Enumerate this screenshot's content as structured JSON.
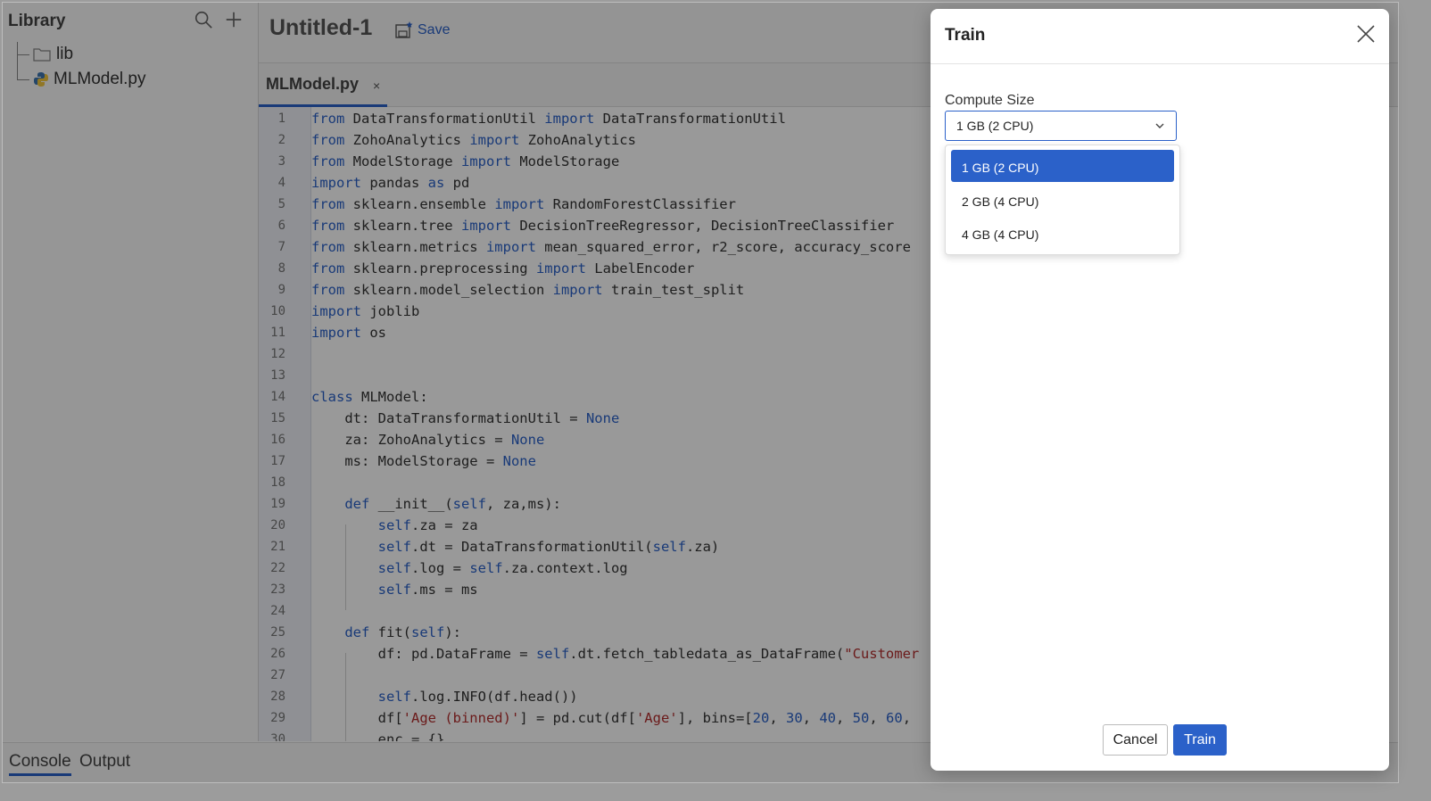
{
  "sidebar": {
    "title": "Library",
    "tree": [
      {
        "label": "lib",
        "icon": "folder-icon"
      },
      {
        "label": "MLModel.py",
        "icon": "python-file-icon"
      }
    ]
  },
  "topbar": {
    "doc_title": "Untitled-1",
    "save_label": "Save"
  },
  "tabs": [
    {
      "label": "MLModel.py",
      "close": "×"
    }
  ],
  "editor": {
    "line_numbers": [
      "1",
      "2",
      "3",
      "4",
      "5",
      "6",
      "7",
      "8",
      "9",
      "10",
      "11",
      "12",
      "13",
      "14",
      "15",
      "16",
      "17",
      "18",
      "19",
      "20",
      "21",
      "22",
      "23",
      "24",
      "25",
      "26",
      "27",
      "28",
      "29",
      "30"
    ]
  },
  "bottom_tabs": [
    "Console",
    "Output"
  ],
  "modal": {
    "title": "Train",
    "field_label": "Compute Size",
    "selected_value": "1 GB (2 CPU)",
    "options": [
      "1 GB (2 CPU)",
      "2 GB (4 CPU)",
      "4 GB (4 CPU)"
    ],
    "cancel_label": "Cancel",
    "train_label": "Train"
  },
  "colors": {
    "accent": "#2b61c9",
    "keyword": "#2b61c9",
    "string": "#b32d2d"
  }
}
